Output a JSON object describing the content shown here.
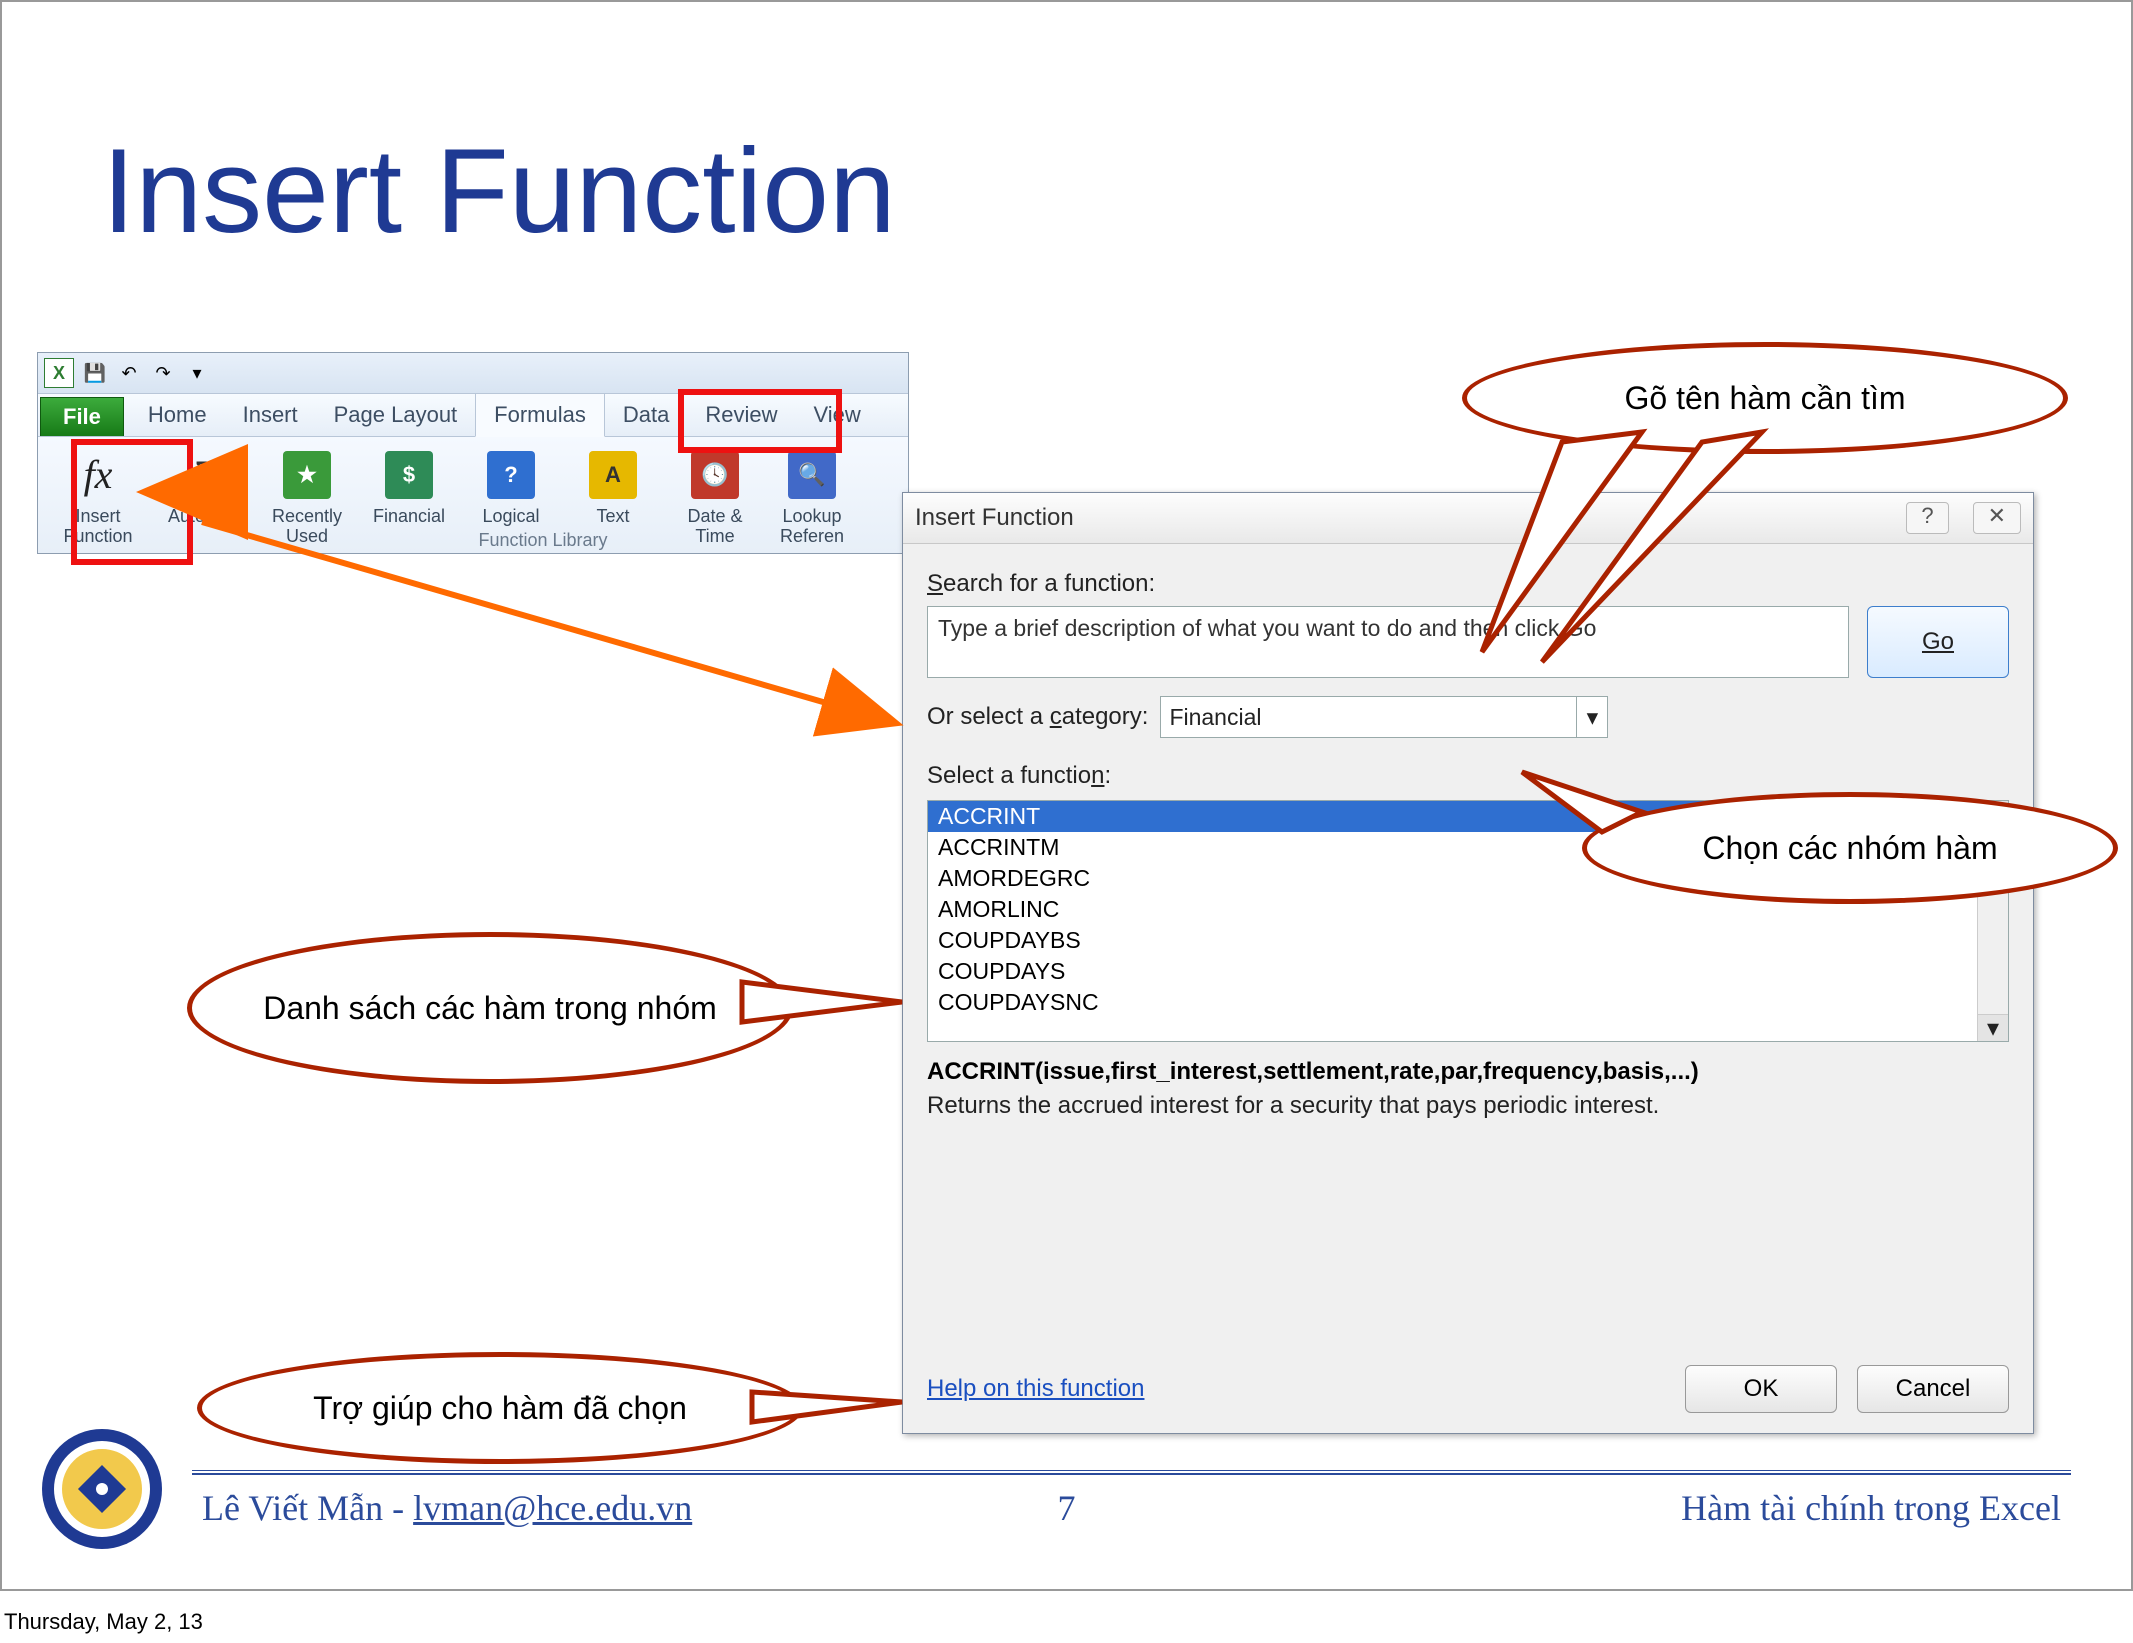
{
  "slide": {
    "title": "Insert Function"
  },
  "ribbon": {
    "file_tab": "File",
    "tabs": [
      "Home",
      "Insert",
      "Page Layout",
      "Formulas",
      "Data",
      "Review",
      "View"
    ],
    "active_tab": "Formulas",
    "group_label": "Function Library",
    "buttons": {
      "insert_function": "Insert\nFunction",
      "autosum": "AutoSum",
      "recently_used": "Recently\nUsed",
      "financial": "Financial",
      "logical": "Logical",
      "text": "Text",
      "date_time": "Date &\nTime",
      "lookup_ref": "Lookup\nReferen"
    }
  },
  "dialog": {
    "title": "Insert Function",
    "search_label": "Search for a function:",
    "search_value": "Type a brief description of what you want to do and then click Go",
    "go": "Go",
    "category_label": "Or select a category:",
    "category_value": "Financial",
    "select_fn_label": "Select a function:",
    "functions": [
      "ACCRINT",
      "ACCRINTM",
      "AMORDEGRC",
      "AMORLINC",
      "COUPDAYBS",
      "COUPDAYS",
      "COUPDAYSNC"
    ],
    "selected_function": "ACCRINT",
    "signature": "ACCRINT(issue,first_interest,settlement,rate,par,frequency,basis,...)",
    "description": "Returns the accrued interest for a security that pays periodic interest.",
    "help_link": "Help on this function",
    "ok": "OK",
    "cancel": "Cancel"
  },
  "callouts": {
    "search_hint": "Gõ tên hàm cần tìm",
    "category_hint": "Chọn các nhóm hàm",
    "list_hint": "Danh sách các hàm trong nhóm",
    "help_hint": "Trợ giúp cho hàm đã chọn"
  },
  "footer": {
    "author_name": "Lê Viết Mẫn - ",
    "author_email": "lvman@hce.edu.vn",
    "page": "7",
    "topic": "Hàm tài chính trong Excel",
    "date": "Thursday, May 2, 13"
  }
}
